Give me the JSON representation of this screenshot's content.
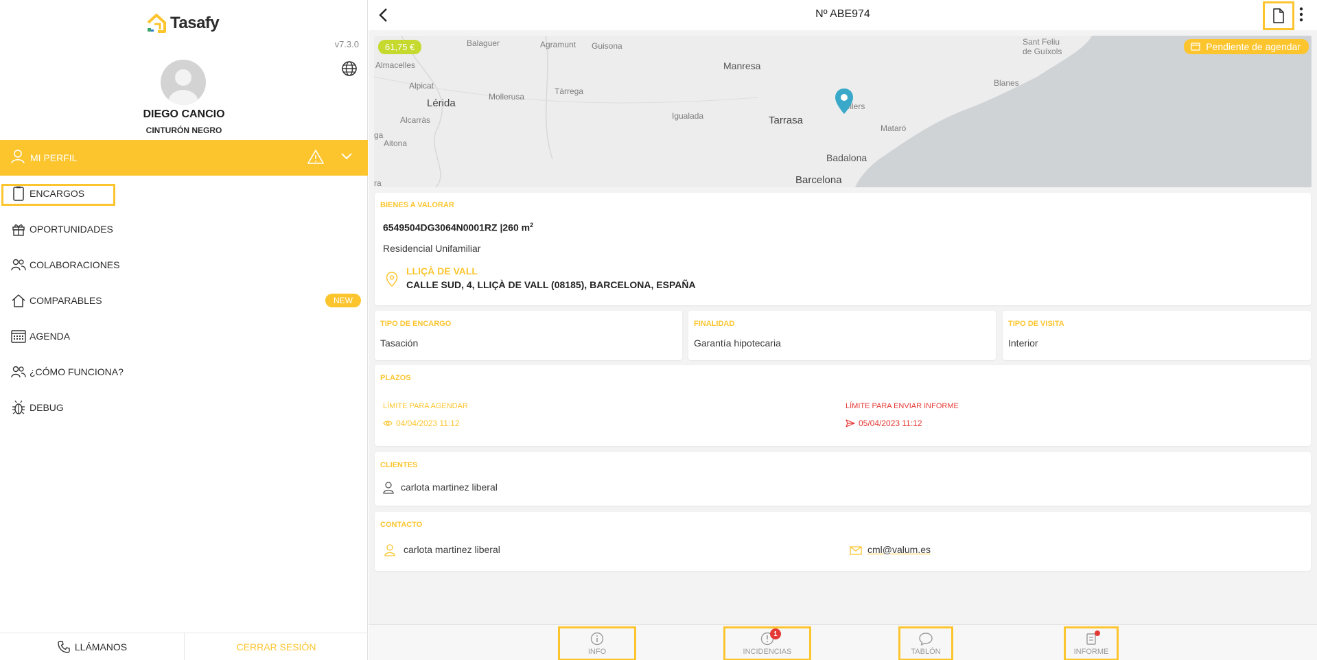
{
  "app": {
    "name": "Tasafy",
    "version": "v7.3.0"
  },
  "user": {
    "name": "DIEGO CANCIO",
    "rank": "CINTURÓN NEGRO"
  },
  "profile": {
    "label": "MI PERFIL"
  },
  "nav": {
    "items": [
      {
        "label": "ENCARGOS",
        "icon": "clipboard-icon"
      },
      {
        "label": "OPORTUNIDADES",
        "icon": "gift-icon"
      },
      {
        "label": "COLABORACIONES",
        "icon": "users-icon"
      },
      {
        "label": "COMPARABLES",
        "icon": "house-icon",
        "badge": "NEW"
      },
      {
        "label": "AGENDA",
        "icon": "calendar-icon"
      },
      {
        "label": "¿CÓMO FUNCIONA?",
        "icon": "users-icon"
      },
      {
        "label": "DEBUG",
        "icon": "bug-icon"
      }
    ]
  },
  "footer": {
    "call": "LLÁMANOS",
    "logout": "CERRAR SESIÓN"
  },
  "header": {
    "title": "Nº ABE974"
  },
  "map": {
    "price": "61,75 €",
    "status": "Pendiente de agendar",
    "labels": {
      "balaguer": "Balaguer",
      "agramunt": "Agramunt",
      "guisona": "Guisona",
      "almacelles": "Almacelles",
      "manresa": "Manresa",
      "sanfeliu": "Sant Feliu",
      "guixols": "de Guíxols",
      "alpicat": "Alpicat",
      "tarrega": "Tàrrega",
      "lerida": "Lérida",
      "mollerusa": "Mollerusa",
      "blanes": "Blanes",
      "granollers": "nollers",
      "alcarras": "Alcarràs",
      "igualada": "Igualada",
      "tarrasa": "Tarrasa",
      "mataro": "Mataró",
      "aitona": "Aitona",
      "ga": "ga",
      "badalona": "Badalona",
      "barcelona": "Barcelona",
      "ra": "ra"
    }
  },
  "bienes": {
    "label": "BIENES A VALORAR",
    "ref": "6549504DG3064N0001RZ |260 m",
    "sup": "2",
    "type": "Residencial Unifamiliar",
    "town": "LLIÇÀ DE VALL",
    "address": "CALLE SUD, 4, LLIÇÀ DE VALL (08185), BARCELONA, ESPAÑA"
  },
  "tipo_encargo": {
    "label": "TIPO DE ENCARGO",
    "value": "Tasación"
  },
  "finalidad": {
    "label": "FINALIDAD",
    "value": "Garantía hipotecaria"
  },
  "tipo_visita": {
    "label": "TIPO DE VISITA",
    "value": "Interior"
  },
  "plazos": {
    "label": "PLAZOS",
    "agendar_label": "LÍMITE PARA AGENDAR",
    "agendar_value": "04/04/2023 11:12",
    "informe_label": "LÍMITE PARA ENVIAR INFORME",
    "informe_value": "05/04/2023 11:12"
  },
  "clientes": {
    "label": "CLIENTES",
    "name": "carlota martinez liberal"
  },
  "contacto": {
    "label": "CONTACTO",
    "name": "carlota martinez liberal",
    "email": "cml@valum.es"
  },
  "tabs": {
    "info": "INFO",
    "incidencias": "INCIDENCIAS",
    "incidencias_count": "1",
    "tablon": "TABLÓN",
    "informe": "INFORME"
  },
  "colors": {
    "accent": "#fcc52e",
    "danger": "#e53935",
    "price": "#c5d92e",
    "pin": "#3aa9c9"
  }
}
